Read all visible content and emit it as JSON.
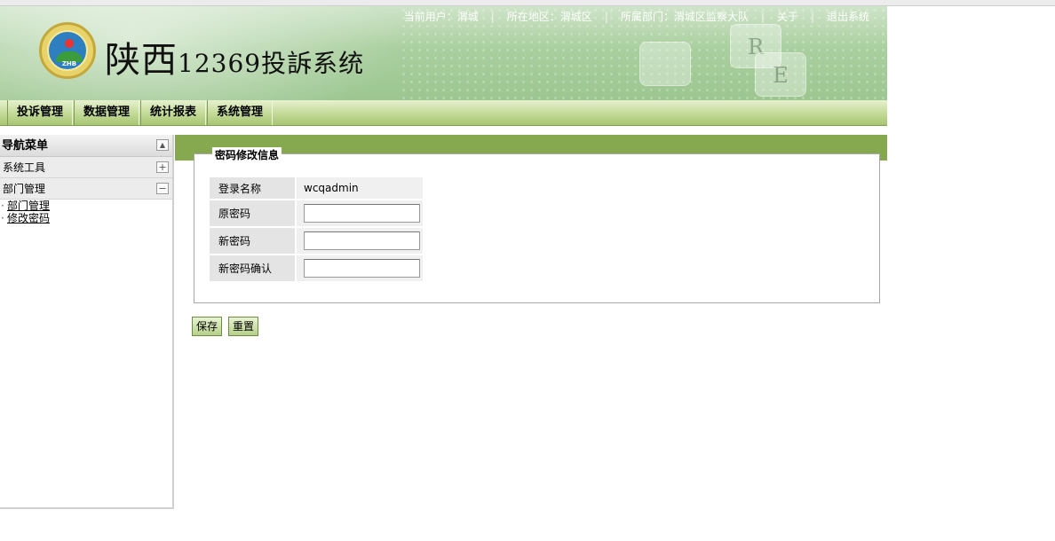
{
  "header": {
    "system_title_main": "陕西",
    "system_title_rest": "12369投訴系统",
    "logo_text": "ZHB",
    "user_bar": [
      {
        "label": "当前用户：渭城"
      },
      {
        "label": "所在地区：渭城区"
      },
      {
        "label": "所属部门：渭城区监察大队"
      },
      {
        "label": "关于"
      },
      {
        "label": "退出系统"
      }
    ],
    "separator": "|"
  },
  "nav": {
    "items": [
      "投诉管理",
      "数据管理",
      "统计报表",
      "系统管理"
    ]
  },
  "sidebar": {
    "title": "导航菜单",
    "groups": [
      {
        "label": "系统工具",
        "toggle": "+"
      },
      {
        "label": "部门管理",
        "toggle": "−"
      }
    ],
    "links": [
      "部门管理",
      "修改密码"
    ],
    "collapse_toggle": "▲"
  },
  "main": {
    "legend": "密码修改信息",
    "fields": {
      "login_name_label": "登录名称",
      "login_name_value": "wcqadmin",
      "old_pw_label": "原密码",
      "new_pw_label": "新密码",
      "confirm_pw_label": "新密码确认"
    },
    "buttons": {
      "save": "保存",
      "reset": "重置"
    }
  },
  "colors": {
    "nav_border": "#809c55",
    "main_bar": "#86a84f"
  }
}
